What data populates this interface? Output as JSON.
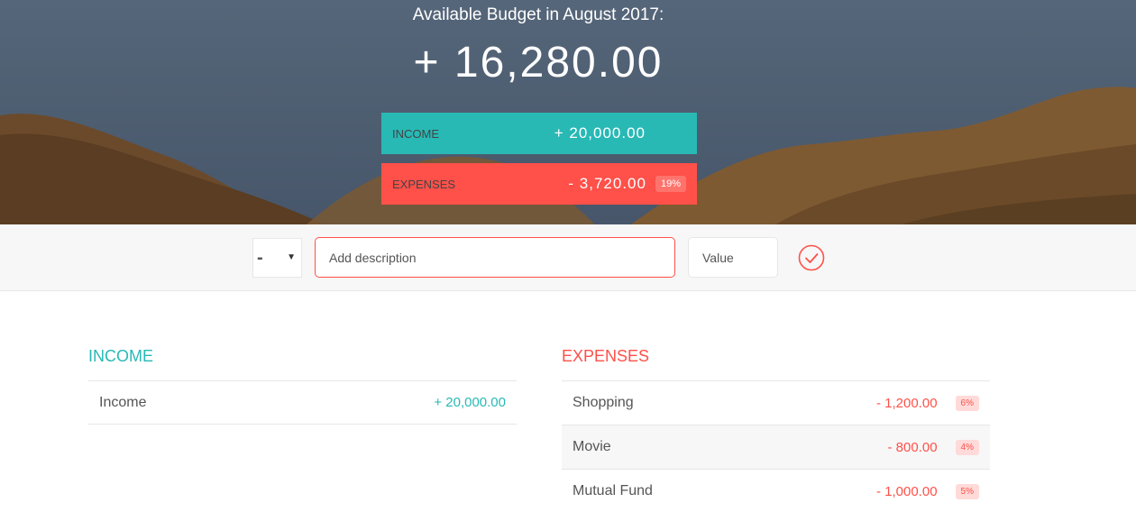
{
  "header": {
    "title": "Available Budget in August 2017:",
    "budget": "+ 16,280.00"
  },
  "summary": {
    "income": {
      "label": "Income",
      "amount": "+ 20,000.00"
    },
    "expenses": {
      "label": "Expenses",
      "amount": "- 3,720.00",
      "percentage": "19%"
    }
  },
  "add_form": {
    "type_value": "-",
    "description_placeholder": "Add description",
    "value_placeholder": "Value"
  },
  "income": {
    "title": "Income",
    "items": [
      {
        "description": "Income",
        "value": "+ 20,000.00"
      }
    ]
  },
  "expenses": {
    "title": "Expenses",
    "items": [
      {
        "description": "Shopping",
        "value": "- 1,200.00",
        "percentage": "6%"
      },
      {
        "description": "Movie",
        "value": "- 800.00",
        "percentage": "4%"
      },
      {
        "description": "Mutual Fund",
        "value": "- 1,000.00",
        "percentage": "5%"
      }
    ]
  },
  "colors": {
    "income": "#28b9b5",
    "expenses": "#ff5049"
  },
  "icons": {
    "add": "check-circle-icon",
    "type_caret": "caret-down-icon"
  }
}
